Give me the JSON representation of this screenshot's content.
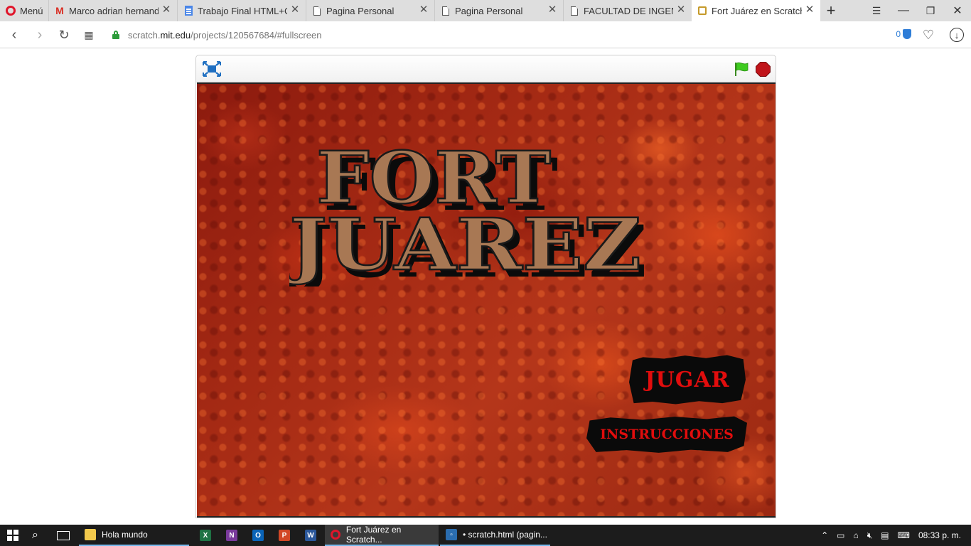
{
  "browser": {
    "menu_label": "Menú",
    "tabs": [
      {
        "title": "Marco adrian hernandez",
        "icon": "gmail-icon"
      },
      {
        "title": "Trabajo Final HTML+CSS",
        "icon": "google-docs-icon"
      },
      {
        "title": "Pagina Personal",
        "icon": "document-icon"
      },
      {
        "title": "Pagina Personal",
        "icon": "document-icon"
      },
      {
        "title": "FACULTAD DE INGENIERÍA",
        "icon": "document-icon"
      },
      {
        "title": "Fort Juárez en Scratch",
        "icon": "scratch-icon",
        "active": true
      }
    ],
    "url_host": "scratch.",
    "url_domain": "mit.edu",
    "url_path": "/projects/120567684/#fullscreen",
    "adblock_count": "0"
  },
  "game": {
    "title_line1": "FORT",
    "title_line2": "JUAREZ",
    "play_button": "JUGAR",
    "instructions_button": "INSTRUCCIONES",
    "title_color": "#a87854",
    "button_text_color": "#e10d0d"
  },
  "taskbar": {
    "folder_label": "Hola mundo",
    "task_opera": "Fort Juárez en Scratch...",
    "task_editor": "• scratch.html (pagin...",
    "clock": "08:33 p. m."
  }
}
